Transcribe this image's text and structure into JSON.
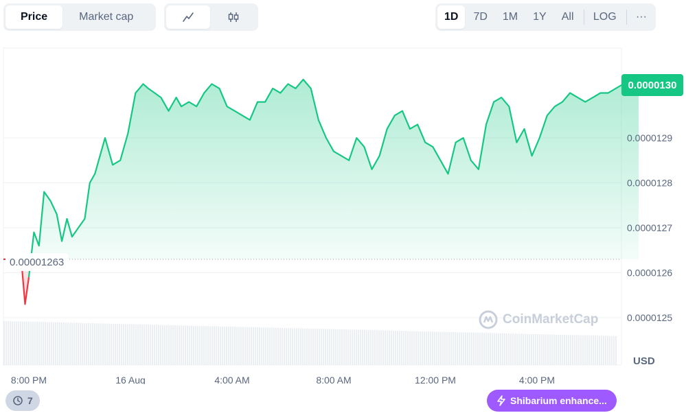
{
  "toolbar": {
    "metric_tabs": [
      {
        "label": "Price",
        "active": true
      },
      {
        "label": "Market cap",
        "active": false
      }
    ],
    "chart_type_icons": [
      {
        "icon": "line-chart-icon",
        "active": true
      },
      {
        "icon": "candlestick-icon",
        "active": false
      }
    ],
    "ranges": [
      {
        "label": "1D",
        "active": true
      },
      {
        "label": "7D",
        "active": false
      },
      {
        "label": "1M",
        "active": false
      },
      {
        "label": "1Y",
        "active": false
      },
      {
        "label": "All",
        "active": false
      }
    ],
    "log_label": "LOG",
    "more_label": "···"
  },
  "current_price": "0.0000130",
  "baseline_label": "0.00001263",
  "currency_label": "USD",
  "watermark": "CoinMarketCap",
  "history_count": "7",
  "news_pill": "Shibarium enhance...",
  "colors": {
    "up": "#16c784",
    "down": "#ea3943",
    "accent": "#9e5aff"
  },
  "chart_data": {
    "type": "area",
    "title": "",
    "xlabel": "",
    "ylabel": "USD",
    "x_tick_labels": [
      "8:00 PM",
      "16 Aug",
      "4:00 AM",
      "8:00 AM",
      "12:00 PM",
      "4:00 PM"
    ],
    "x_tick_hours": [
      0,
      4,
      8,
      12,
      16,
      20
    ],
    "y_ticks": [
      1.25e-05,
      1.26e-05,
      1.27e-05,
      1.28e-05,
      1.29e-05
    ],
    "y_tick_labels": [
      "0.0000125",
      "0.0000126",
      "0.0000127",
      "0.0000128",
      "0.0000129"
    ],
    "ylim": [
      1.248e-05,
      1.307e-05
    ],
    "baseline": 1.263e-05,
    "grid": true,
    "series": [
      {
        "x": [
          -0.3,
          -0.15,
          0,
          0.2,
          0.4,
          0.6,
          0.85,
          1.1,
          1.3,
          1.5,
          1.7,
          1.95,
          2.2,
          2.4,
          2.6,
          2.8,
          3.0,
          3.3,
          3.6,
          3.9,
          4.2,
          4.5,
          4.7,
          4.95,
          5.2,
          5.5,
          5.8,
          6.0,
          6.3,
          6.6,
          6.9,
          7.2,
          7.5,
          7.8,
          8.1,
          8.4,
          8.7,
          9.0,
          9.3,
          9.6,
          9.9,
          10.2,
          10.5,
          10.8,
          11.1,
          11.4,
          11.7,
          12.0,
          12.3,
          12.6,
          12.9,
          13.2,
          13.5,
          13.8,
          14.1,
          14.4,
          14.7,
          15.0,
          15.3,
          15.6,
          15.9,
          16.2,
          16.5,
          16.8,
          17.1,
          17.4,
          17.7,
          18.0,
          18.3,
          18.6,
          18.9,
          19.2,
          19.5,
          19.8,
          20.1,
          20.4,
          20.7,
          21.0,
          21.3,
          21.6,
          21.9,
          22.2,
          22.5,
          22.8,
          23.1,
          23.4,
          23.7,
          24.0
        ],
        "y": [
          1.263e-05,
          1.253e-05,
          1.259e-05,
          1.269e-05,
          1.266e-05,
          1.278e-05,
          1.276e-05,
          1.273e-05,
          1.267e-05,
          1.272e-05,
          1.268e-05,
          1.27e-05,
          1.272e-05,
          1.28e-05,
          1.282e-05,
          1.286e-05,
          1.29e-05,
          1.284e-05,
          1.285e-05,
          1.291e-05,
          1.3e-05,
          1.302e-05,
          1.301e-05,
          1.3e-05,
          1.299e-05,
          1.296e-05,
          1.299e-05,
          1.297e-05,
          1.298e-05,
          1.297e-05,
          1.3e-05,
          1.302e-05,
          1.301e-05,
          1.297e-05,
          1.296e-05,
          1.295e-05,
          1.294e-05,
          1.298e-05,
          1.298e-05,
          1.301e-05,
          1.3e-05,
          1.302e-05,
          1.301e-05,
          1.303e-05,
          1.301e-05,
          1.294e-05,
          1.29e-05,
          1.287e-05,
          1.286e-05,
          1.285e-05,
          1.29e-05,
          1.288e-05,
          1.283e-05,
          1.286e-05,
          1.292e-05,
          1.295e-05,
          1.296e-05,
          1.292e-05,
          1.293e-05,
          1.289e-05,
          1.288e-05,
          1.285e-05,
          1.282e-05,
          1.289e-05,
          1.29e-05,
          1.285e-05,
          1.283e-05,
          1.293e-05,
          1.298e-05,
          1.299e-05,
          1.297e-05,
          1.289e-05,
          1.292e-05,
          1.286e-05,
          1.29e-05,
          1.295e-05,
          1.297e-05,
          1.298e-05,
          1.3e-05,
          1.299e-05,
          1.298e-05,
          1.299e-05,
          1.3e-05,
          1.3e-05,
          1.301e-05,
          1.302e-05,
          1.304e-05,
          1.302e-05
        ]
      }
    ]
  }
}
